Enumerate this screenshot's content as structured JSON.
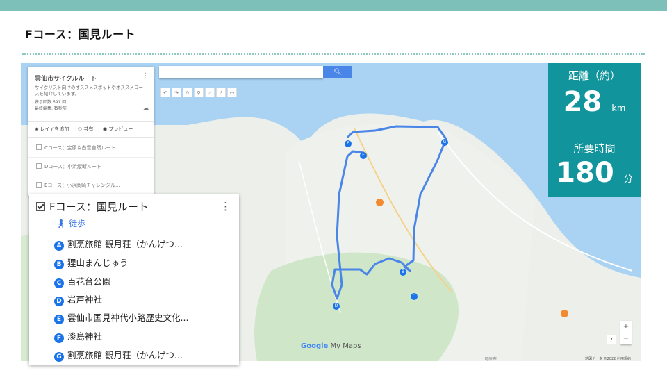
{
  "slide": {
    "title": "Fコース：国見ルート"
  },
  "panel": {
    "title": "雲仙市サイクルルート",
    "description": "サイクリスト向けのオススメスポットやオススメコースを紹介しています。",
    "views": "表示回数 691 回",
    "edited": "最終編集: 数秒前",
    "tools": {
      "add_layer": "レイヤを追加",
      "share": "共有",
      "preview": "プレビュー"
    },
    "layers": [
      "Cコース：宝原＆白雲自然ルート",
      "Dコース：小浜縦断ルート",
      "Eコース：小浜岡崎チャレンジル..."
    ]
  },
  "stats": {
    "distance_label": "距離（約）",
    "distance_value": "28",
    "distance_unit": "km",
    "time_label": "所要時間",
    "time_value": "180",
    "time_unit": "分"
  },
  "card": {
    "title": "Fコース：国見ルート",
    "mode": "徒歩",
    "items": [
      {
        "letter": "A",
        "label": "割烹旅館 観月荘（かんげつ..."
      },
      {
        "letter": "B",
        "label": "狸山まんじゅう"
      },
      {
        "letter": "C",
        "label": "百花台公園"
      },
      {
        "letter": "D",
        "label": "岩戸神社"
      },
      {
        "letter": "E",
        "label": "雲仙市国見神代小路歴史文化..."
      },
      {
        "letter": "F",
        "label": "淡島神社"
      },
      {
        "letter": "G",
        "label": "割烹旅館 観月荘（かんげつ..."
      }
    ]
  },
  "map": {
    "logo_brand": "Google",
    "logo_product": "My Maps",
    "zoom_in": "+",
    "zoom_out": "−",
    "help": "?",
    "footer": "地図データ ©2022  利用規約",
    "place_label": "島原市",
    "search_icon": "search-icon"
  },
  "colors": {
    "accent": "#11949b",
    "route": "#4a86e8",
    "topbar": "#7dbfb9"
  }
}
